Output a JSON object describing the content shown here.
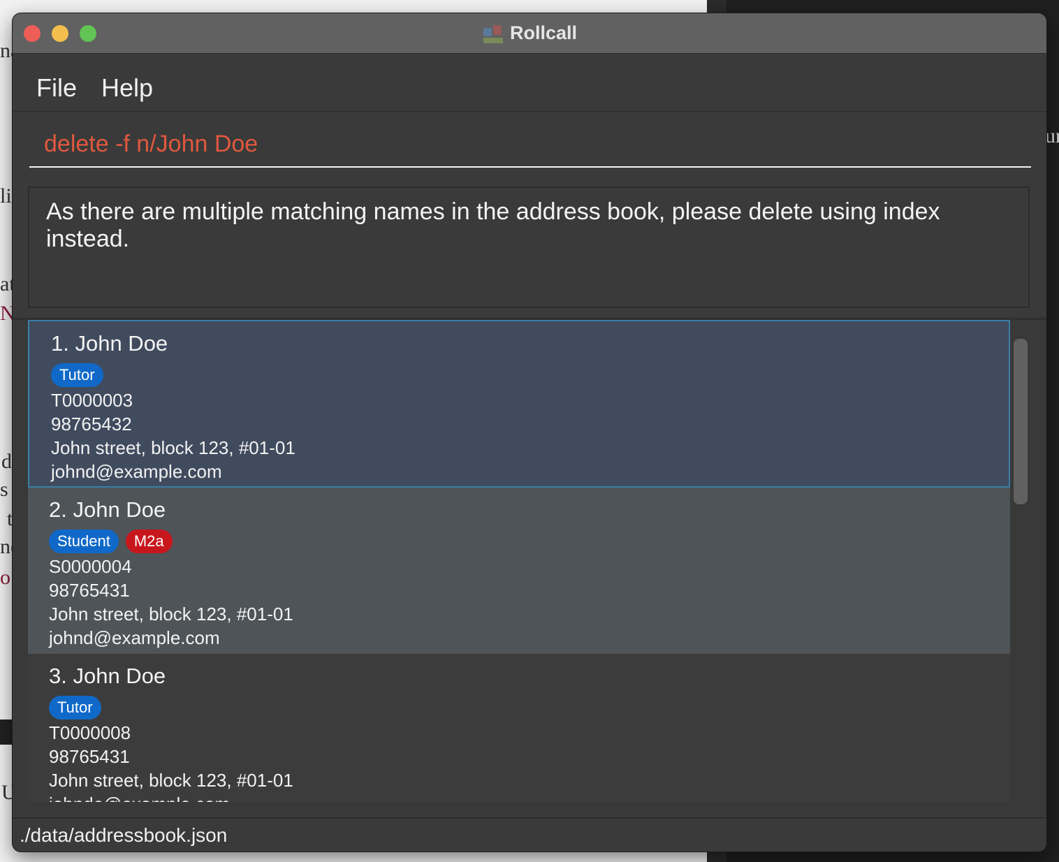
{
  "window": {
    "title": "Rollcall"
  },
  "menu": {
    "items": [
      "File",
      "Help"
    ]
  },
  "command": {
    "value": "delete -f n/John Doe"
  },
  "result": {
    "message": "As there are multiple matching names in the address book, please delete using index instead."
  },
  "persons": [
    {
      "name": "1. John Doe",
      "tags": [
        {
          "label": "Tutor",
          "color": "#1069c8"
        }
      ],
      "id": "T0000003",
      "phone": "98765432",
      "address": "John street, block 123, #01-01",
      "email": "johnd@example.com"
    },
    {
      "name": "2. John Doe",
      "tags": [
        {
          "label": "Student",
          "color": "#1069c8"
        },
        {
          "label": "M2a",
          "color": "#c8161d"
        }
      ],
      "id": "S0000004",
      "phone": "98765431",
      "address": "John street, block 123, #01-01",
      "email": "johnd@example.com"
    },
    {
      "name": "3. John Doe",
      "tags": [
        {
          "label": "Tutor",
          "color": "#1069c8"
        }
      ],
      "id": "T0000008",
      "phone": "98765431",
      "address": "John street, block 123, #01-01",
      "email": "johnde@example.com"
    }
  ],
  "status": {
    "file_path": "./data/addressbook.json"
  },
  "background_fragments": [
    "na",
    "lis",
    "at",
    "N",
    "d",
    "s",
    "t",
    "ne",
    "o",
    "U",
    "ur"
  ]
}
